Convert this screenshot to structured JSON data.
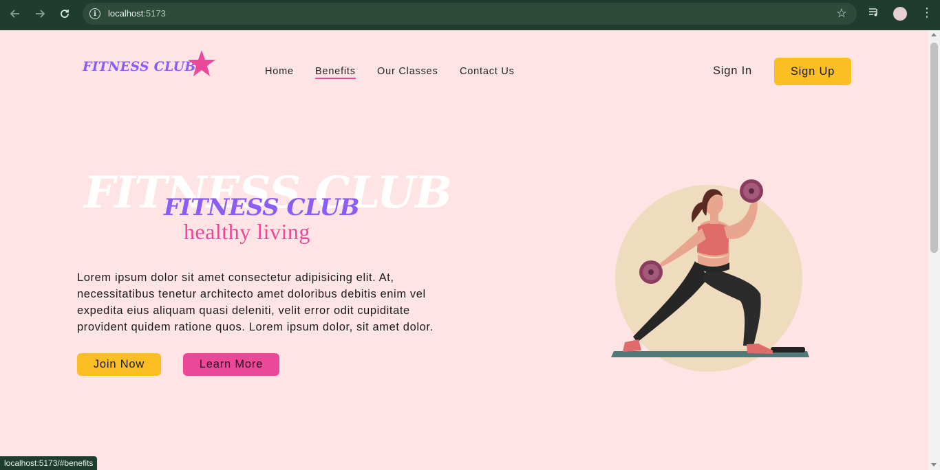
{
  "browser": {
    "url_host": "localhost",
    "url_port": ":5173",
    "status_url": "localhost:5173/#benefits",
    "icons": {
      "back": "arrow-left-icon",
      "forward": "arrow-right-icon",
      "reload": "reload-icon",
      "site_info": "info-icon",
      "bookmark": "star-icon",
      "media": "media-icon",
      "menu": "more-vert-icon"
    }
  },
  "header": {
    "logo_text": "FITNESS CLUB",
    "nav": [
      {
        "label": "Home",
        "current": false
      },
      {
        "label": "Benefits",
        "current": true
      },
      {
        "label": "Our Classes",
        "current": false
      },
      {
        "label": "Contact Us",
        "current": false
      }
    ],
    "sign_in": "Sign In",
    "sign_up": "Sign Up"
  },
  "hero": {
    "background_text": "FITNESS CLUB",
    "title": "FITNESS CLUB",
    "subtitle": "healthy living",
    "paragraph": "Lorem ipsum dolor sit amet consectetur adipisicing elit. At, necessitatibus tenetur architecto amet doloribus debitis enim vel expedita eius aliquam quasi deleniti, velit error odit cupiditate provident quidem ratione quos. Lorem ipsum dolor, sit amet dolor.",
    "join_button": "Join Now",
    "learn_button": "Learn More"
  },
  "colors": {
    "page_bg": "#ffe4e6",
    "primary_purple": "#8b5cf6",
    "accent_pink": "#ec4899",
    "accent_yellow": "#fbbf24",
    "chrome_bg": "#1f3d2e"
  }
}
